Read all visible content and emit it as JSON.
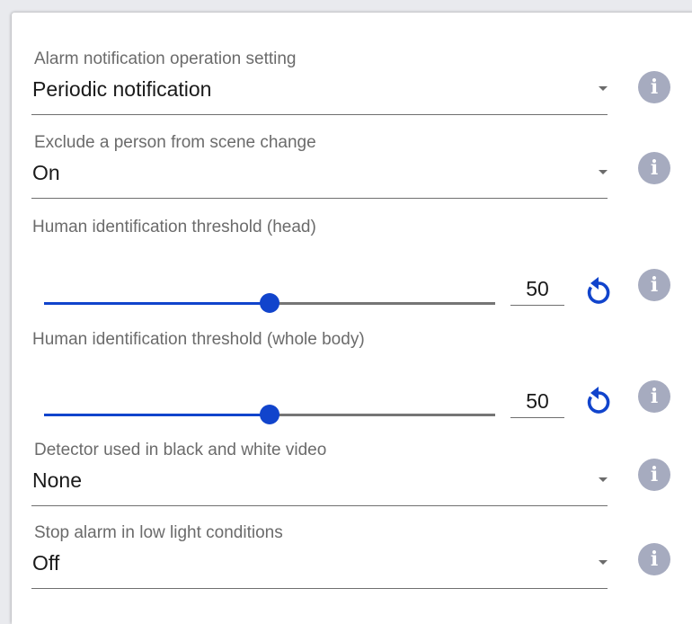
{
  "settings": {
    "alarm_notification": {
      "label": "Alarm notification operation setting",
      "value": "Periodic notification"
    },
    "exclude_person": {
      "label": "Exclude a person from scene change",
      "value": "On"
    },
    "threshold_head": {
      "label": "Human identification threshold (head)",
      "value": "50",
      "level_percent": 50
    },
    "threshold_body": {
      "label": "Human identification threshold (whole body)",
      "value": "50",
      "level_percent": 50
    },
    "bw_detector": {
      "label": "Detector used in black and white video",
      "value": "None"
    },
    "low_light_stop": {
      "label": "Stop alarm in low light conditions",
      "value": "Off"
    }
  },
  "icons": {
    "info": "info-icon",
    "reset": "reset-icon",
    "dropdown": "chevron-down-icon"
  },
  "info_glyph": "i",
  "colors": {
    "accent": "#1144cc",
    "info_circle": "#a6abbf",
    "label_text": "#6b6b6b",
    "underline": "#6f6f6f"
  }
}
